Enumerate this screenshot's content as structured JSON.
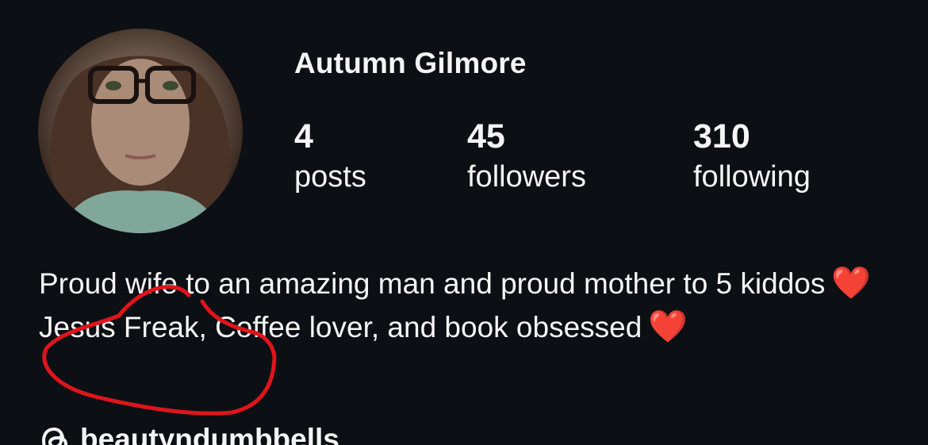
{
  "profile": {
    "username": "Autumn Gilmore",
    "avatar_icon": "profile-photo"
  },
  "stats": {
    "posts": {
      "value": "4",
      "label": "posts"
    },
    "followers": {
      "value": "45",
      "label": "followers"
    },
    "following": {
      "value": "310",
      "label": "following"
    }
  },
  "bio": {
    "line1": "Proud wife to an amazing man and proud mother to 5 kiddos",
    "line1_emoji": "❤️",
    "line2": "Jesus Freak, Coffee lover, and book obsessed",
    "line2_emoji": "❤️"
  },
  "threads": {
    "handle": "beautyndumbbells",
    "icon": "threads-icon"
  },
  "colors": {
    "background": "#0c1014",
    "text": "#f5f5f5",
    "annotation_circle": "#e0141c",
    "heart": "#ff2d2d"
  }
}
